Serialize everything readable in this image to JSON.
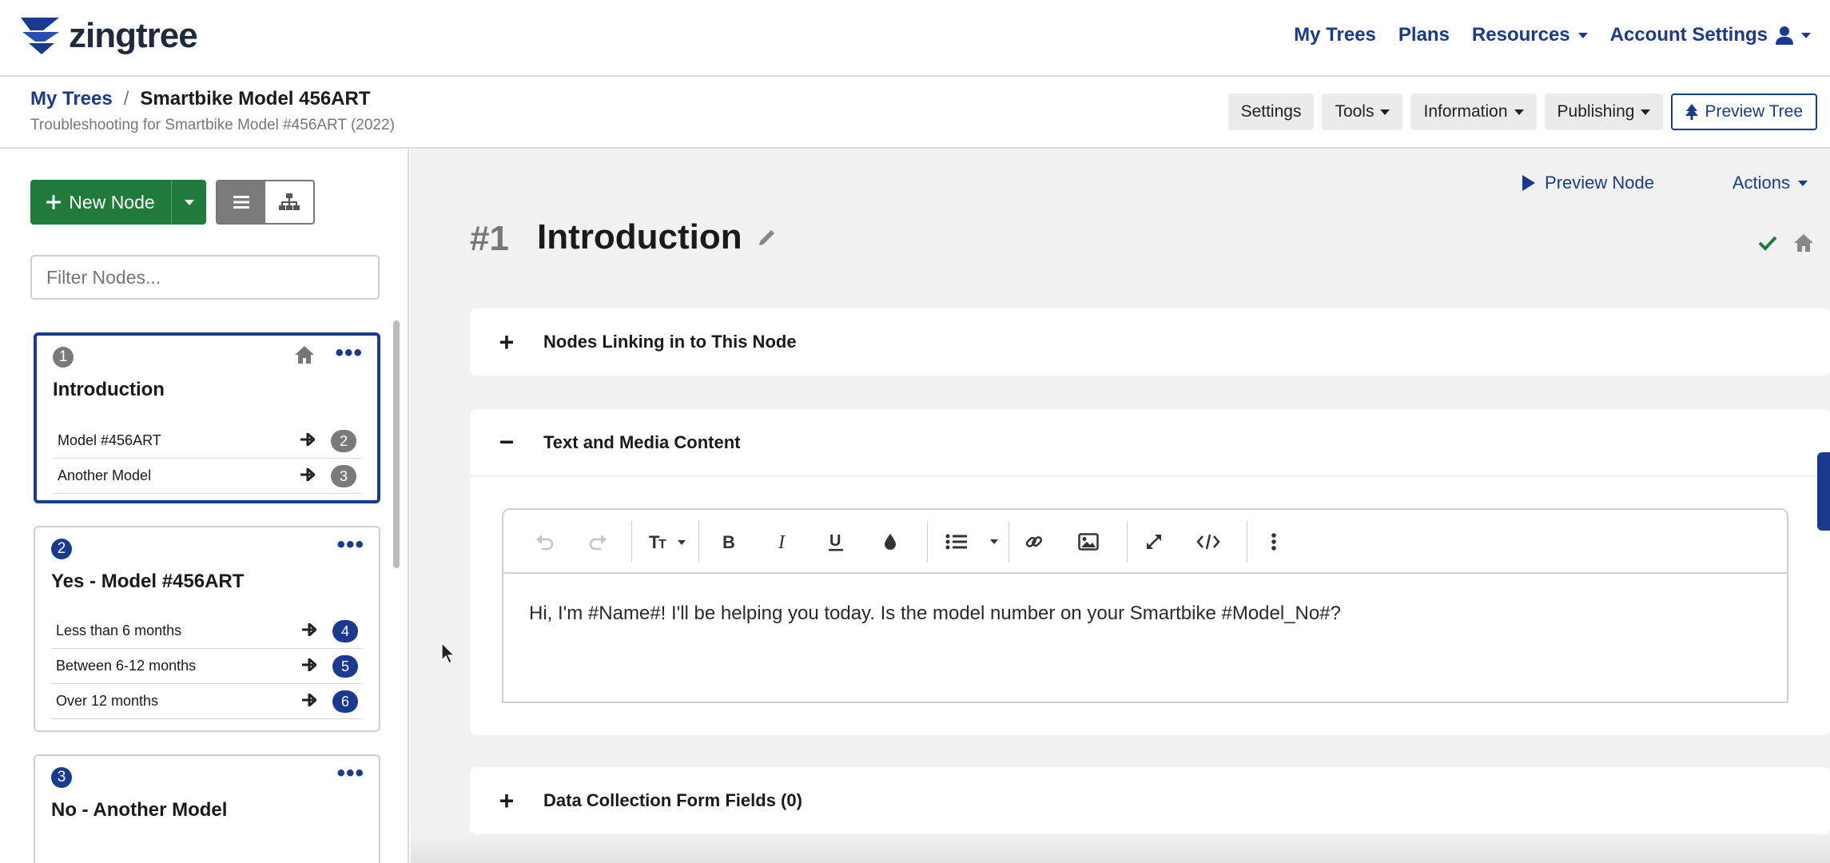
{
  "topnav": {
    "brand": "zingtree",
    "links": [
      "My Trees",
      "Plans",
      "Resources",
      "Account Settings"
    ]
  },
  "header": {
    "breadcrumb_root": "My Trees",
    "breadcrumb_sep": "/",
    "tree_name": "Smartbike Model 456ART",
    "subtitle": "Troubleshooting for Smartbike Model #456ART (2022)",
    "buttons": [
      "Settings",
      "Tools",
      "Information",
      "Publishing",
      "Preview Tree"
    ]
  },
  "sidebar": {
    "new_node_label": "New Node",
    "filter_placeholder": "Filter Nodes...",
    "nodes": [
      {
        "num": "1",
        "title": "Introduction",
        "options": [
          {
            "label": "Model #456ART",
            "target": "2"
          },
          {
            "label": "Another Model",
            "target": "3"
          }
        ]
      },
      {
        "num": "2",
        "title": "Yes - Model #456ART",
        "options": [
          {
            "label": "Less than 6 months",
            "target": "4"
          },
          {
            "label": "Between 6-12 months",
            "target": "5"
          },
          {
            "label": "Over 12 months",
            "target": "6"
          }
        ]
      },
      {
        "num": "3",
        "title": "No - Another Model",
        "options": []
      }
    ]
  },
  "main": {
    "preview_node_label": "Preview Node",
    "actions_label": "Actions",
    "node_number": "#1",
    "node_title": "Introduction",
    "panels": {
      "linking": "Nodes Linking in to This Node",
      "content": "Text and Media Content",
      "form_fields": "Data Collection Form Fields (0)"
    },
    "editor_text": "Hi, I'm #Name#! I'll be helping you today. Is the model number on your Smartbike #Model_No#?"
  },
  "colors": {
    "brand_blue": "#1a3a8f",
    "success_green": "#1f7a3c",
    "badge_gray": "#7a7a7a"
  }
}
